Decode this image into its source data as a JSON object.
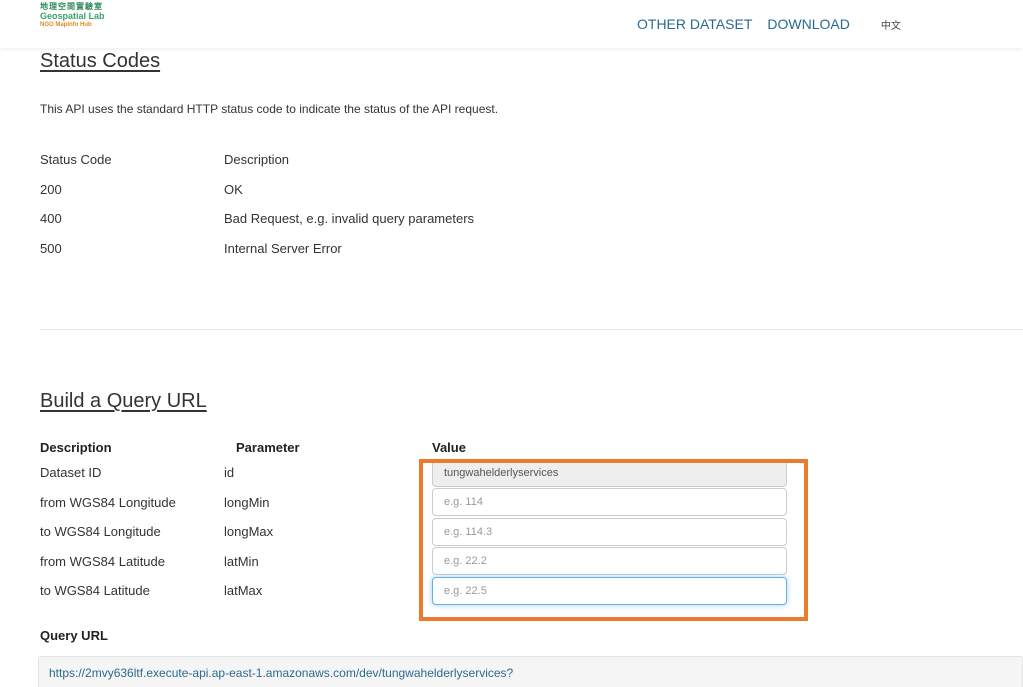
{
  "header": {
    "logo_cn": "地理空間實驗室",
    "logo_en": "Geospatial Lab",
    "logo_sub": "NGO MapInfo Hub",
    "nav": [
      "OTHER DATASET",
      "DOWNLOAD"
    ],
    "lang": "中文"
  },
  "status_section": {
    "title": "Status Codes",
    "intro": "This API uses the standard HTTP status code to indicate the status of the API request.",
    "columns": [
      "Status Code",
      "Description"
    ],
    "rows": [
      {
        "code": "200",
        "desc": "OK"
      },
      {
        "code": "400",
        "desc": "Bad Request, e.g. invalid query parameters"
      },
      {
        "code": "500",
        "desc": "Internal Server Error"
      }
    ]
  },
  "query_section": {
    "title": "Build a Query URL",
    "columns": [
      "Description",
      "Parameter",
      "Value"
    ],
    "rows": [
      {
        "desc": "Dataset ID",
        "param": "id",
        "value": "tungwahelderlyservices",
        "placeholder": ""
      },
      {
        "desc": "from WGS84 Longitude",
        "param": "longMin",
        "value": "",
        "placeholder": "e.g. 114"
      },
      {
        "desc": "to WGS84 Longitude",
        "param": "longMax",
        "value": "",
        "placeholder": "e.g. 114.3"
      },
      {
        "desc": "from WGS84 Latitude",
        "param": "latMin",
        "value": "",
        "placeholder": "e.g. 22.2"
      },
      {
        "desc": "to WGS84 Latitude",
        "param": "latMax",
        "value": "",
        "placeholder": "e.g. 22.5"
      }
    ],
    "query_url_label": "Query URL",
    "query_url": "https://2mvy636ltf.execute-api.ap-east-1.amazonaws.com/dev/tungwahelderlyservices?"
  },
  "colors": {
    "highlight": "#ec7b2d",
    "link": "#2b6a8f",
    "focus": "#66afe9"
  }
}
